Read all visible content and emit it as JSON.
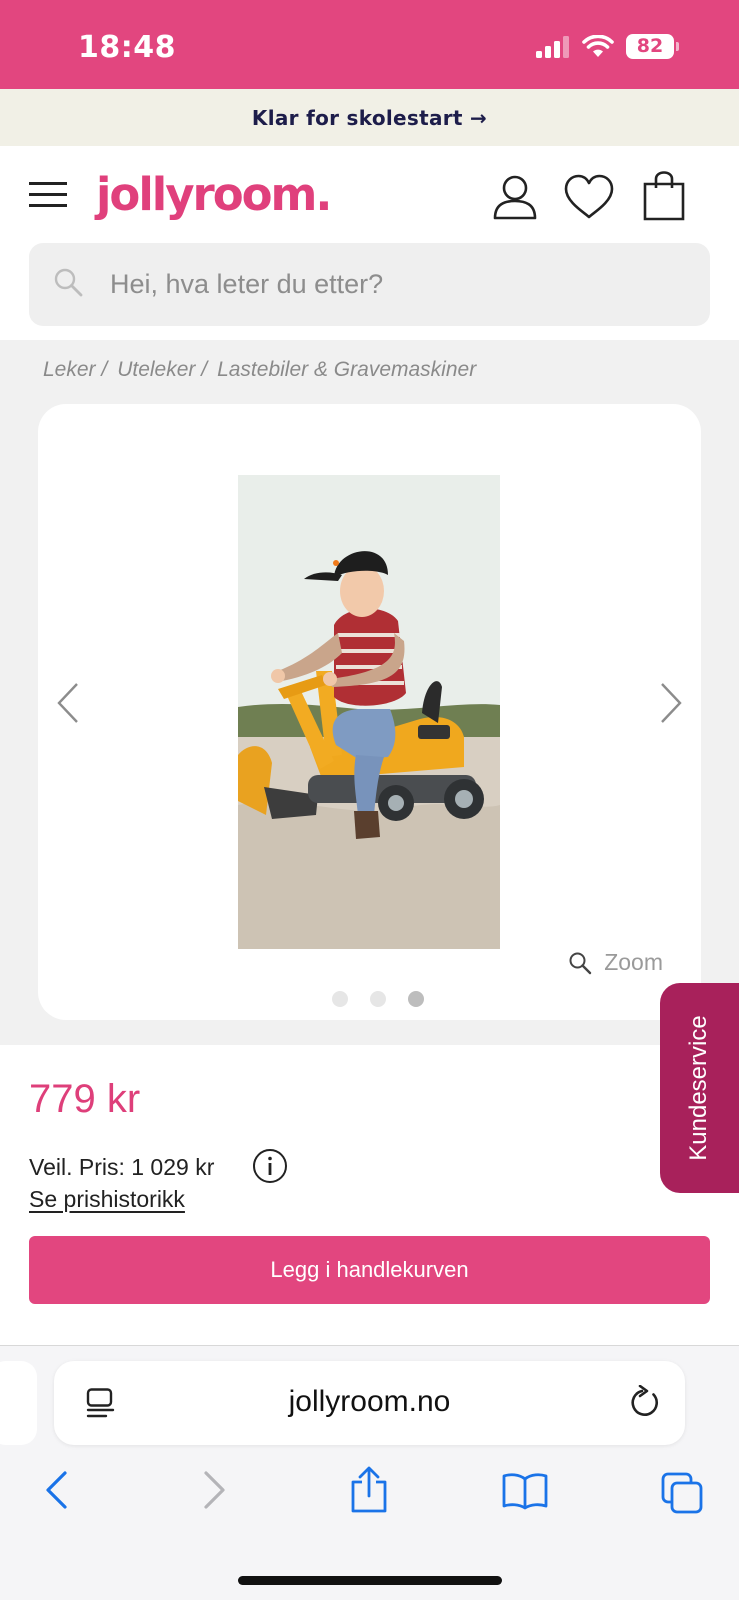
{
  "status_bar": {
    "time": "18:48",
    "battery": "82",
    "icons": [
      "signal-icon",
      "wifi-icon",
      "battery-icon"
    ]
  },
  "promo": {
    "text": "Klar for skolestart →"
  },
  "header": {
    "logo": "jollyroom.",
    "icons": [
      "menu-icon",
      "account-icon",
      "wishlist-heart-icon",
      "shopping-bag-icon"
    ]
  },
  "search": {
    "placeholder": "Hei, hva leter du etter?"
  },
  "breadcrumb": [
    "Leker /",
    "Uteleker /",
    "Lastebiler & Gravemaskiner"
  ],
  "gallery": {
    "zoom_label": "Zoom",
    "dot_count": 3,
    "active_dot": 3
  },
  "product": {
    "price": "779 kr",
    "rrp": "Veil. Pris: 1 029 kr",
    "price_history_link": "Se prishistorikk",
    "add_to_cart": "Legg i handlekurven"
  },
  "support_tab": {
    "label": "Kundeservice"
  },
  "browser": {
    "url": "jollyroom.no",
    "toolbar": [
      "back-icon",
      "forward-icon",
      "share-icon",
      "bookmarks-icon",
      "tabs-icon"
    ]
  },
  "colors": {
    "brand_pink": "#e2467f",
    "support_magenta": "#a8215b",
    "safari_blue": "#1a73e8"
  }
}
